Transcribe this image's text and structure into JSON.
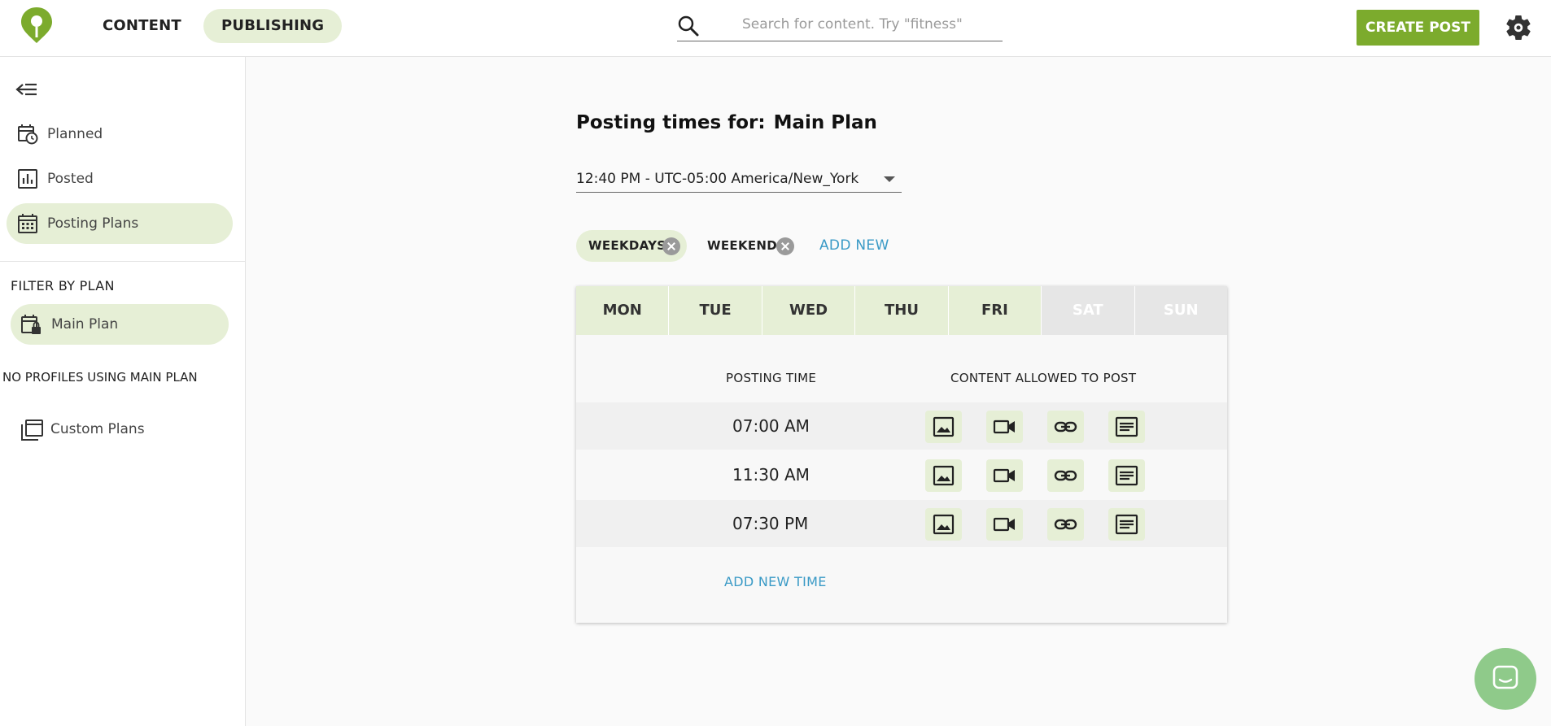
{
  "topbar": {
    "tabs": [
      {
        "label": "CONTENT"
      },
      {
        "label": "PUBLISHING"
      }
    ],
    "search_placeholder": "Search for content. Try \"fitness\"",
    "create_label": "CREATE POST"
  },
  "sidebar": {
    "items": [
      {
        "label": "Planned"
      },
      {
        "label": "Posted"
      },
      {
        "label": "Posting Plans"
      }
    ],
    "filter_title": "FILTER BY PLAN",
    "plan_label": "Main Plan",
    "no_profiles": "NO PROFILES USING MAIN PLAN",
    "custom_label": "Custom Plans"
  },
  "main": {
    "heading_prefix": "Posting times for:",
    "heading_plan": "Main Plan",
    "timezone": "12:40 PM - UTC-05:00 America/New_York",
    "chips": [
      {
        "label": "WEEKDAYS"
      },
      {
        "label": "WEEKENDS"
      }
    ],
    "add_new": "ADD NEW",
    "days": [
      {
        "label": "MON"
      },
      {
        "label": "TUE"
      },
      {
        "label": "WED"
      },
      {
        "label": "THU"
      },
      {
        "label": "FRI"
      },
      {
        "label": "SAT"
      },
      {
        "label": "SUN"
      }
    ],
    "col_posting_time": "POSTING TIME",
    "col_content": "CONTENT ALLOWED TO POST",
    "rows": [
      {
        "time": "07:00 AM"
      },
      {
        "time": "11:30 AM"
      },
      {
        "time": "07:30 PM"
      }
    ],
    "add_time": "ADD NEW TIME"
  },
  "colors": {
    "accent": "#7cab2d",
    "active_bg": "#e6efd6",
    "link": "#3a9ac6"
  },
  "icons": [
    "logo-icon",
    "search-icon",
    "gear-icon",
    "collapse-icon",
    "calendar-clock-icon",
    "chart-icon",
    "calendar-icon",
    "calendar-lock-icon",
    "calendars-icon",
    "image-icon",
    "video-icon",
    "link-icon",
    "text-icon",
    "chat-icon"
  ]
}
